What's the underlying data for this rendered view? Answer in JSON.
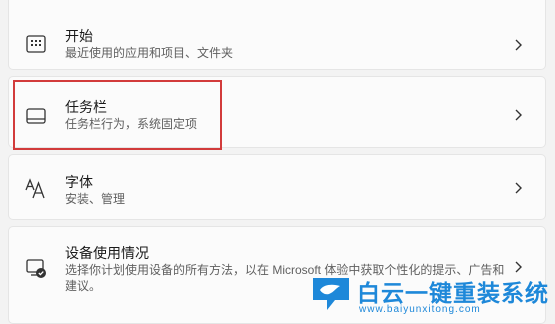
{
  "settings": {
    "items": [
      {
        "title": "开始",
        "subtitle": "最近使用的应用和项目、文件夹"
      },
      {
        "title": "任务栏",
        "subtitle": "任务栏行为，系统固定项"
      },
      {
        "title": "字体",
        "subtitle": "安装、管理"
      },
      {
        "title": "设备使用情况",
        "subtitle": "选择你计划使用设备的所有方法，以在 Microsoft 体验中获取个性化的提示、广告和建议。"
      }
    ]
  },
  "highlight_color": "#d23b3b",
  "watermark": {
    "name": "白云一键重装系统",
    "url": "www.baiyunxitong.com"
  }
}
